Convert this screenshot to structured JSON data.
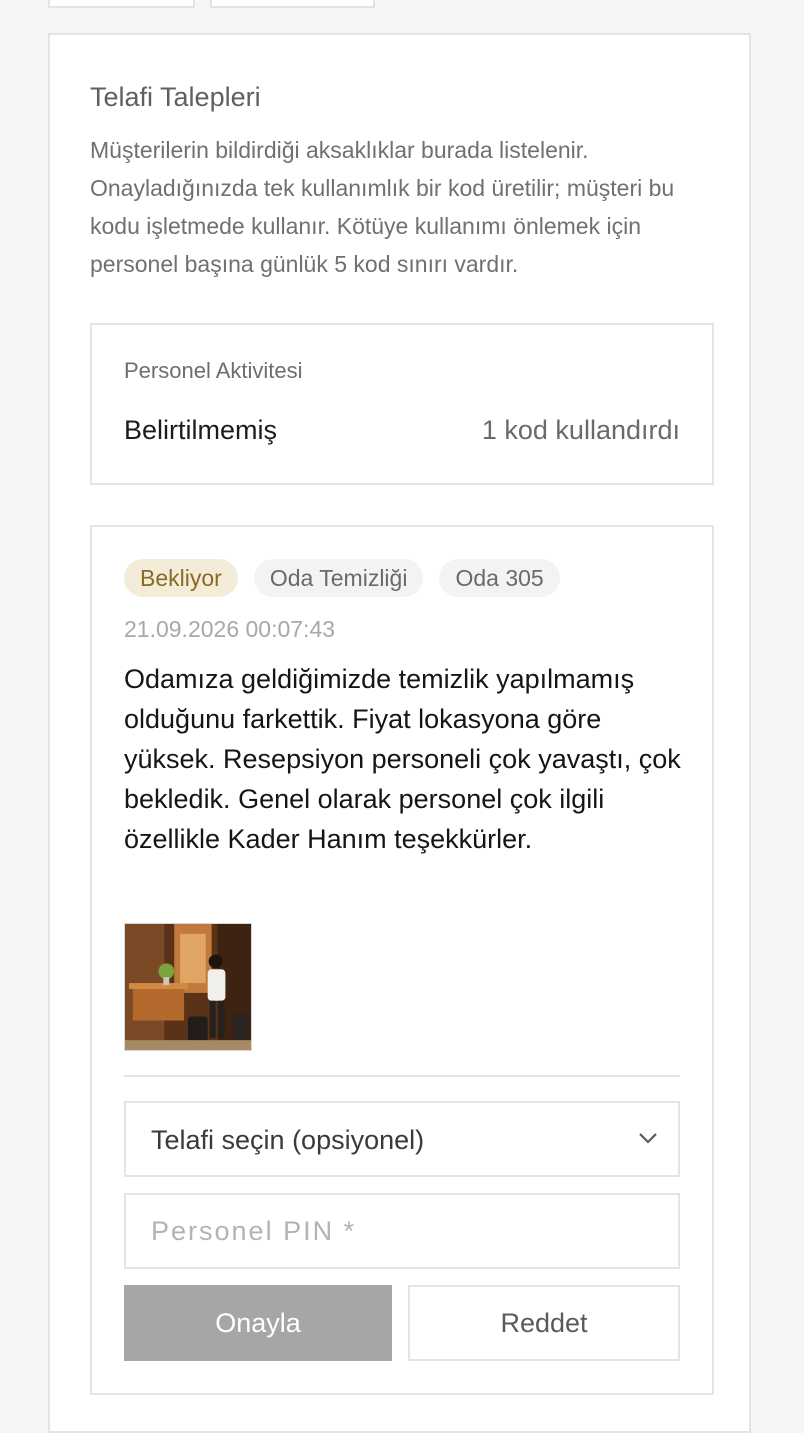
{
  "panel": {
    "title": "Telafi Talepleri",
    "description": "Müşterilerin bildirdiği aksaklıklar burada listelenir. Onayladığınızda tek kullanımlık bir kod üretilir; müşteri bu kodu işletmede kullanır. Kötüye kullanımı önlemek için personel başına günlük 5 kod sınırı vardır."
  },
  "activity": {
    "label": "Personel Aktivitesi",
    "name": "Belirtilmemiş",
    "count": "1 kod kullandırdı"
  },
  "request": {
    "status": "Bekliyor",
    "category": "Oda Temizliği",
    "room": "Oda 305",
    "timestamp": "21.09.2026 00:07:43",
    "message": "Odamıza geldiğimizde temizlik yapılmamış olduğunu farkettik. Fiyat lokasyona göre yüksek. Resepsiyon personeli çok yavaştı, çok bekledik. Genel olarak personel çok ilgili özellikle Kader Hanım teşekkürler.",
    "photo_icon": "hotel-lobby-photo"
  },
  "form": {
    "compensation_select": "Telafi seçin (opsiyonel)",
    "pin_placeholder": "Personel PIN *",
    "approve_label": "Onayla",
    "reject_label": "Reddet"
  },
  "colors": {
    "status_bg": "#f3ecd9",
    "status_text": "#8a6a25",
    "approve_bg": "#a6a6a6",
    "border": "#e4e4e2"
  }
}
